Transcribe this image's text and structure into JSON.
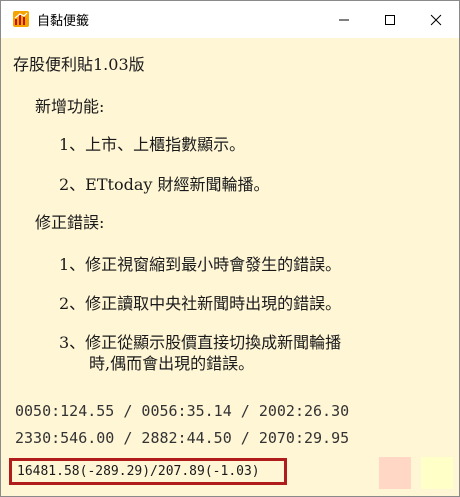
{
  "window": {
    "title": "自黏便籤",
    "controls": {
      "minimize": "minimize",
      "maximize": "maximize",
      "close": "close"
    }
  },
  "note": {
    "heading": "存股便利貼1.03版",
    "new_features_title": "新增功能:",
    "new_features": [
      "1、上市、上櫃指數顯示。",
      "2、ETtoday 財經新聞輪播。"
    ],
    "fixes_title": "修正錯誤:",
    "fixes": [
      "1、修正視窗縮到最小時會發生的錯誤。",
      "2、修正讀取中央社新聞時出現的錯誤。",
      "3、修正從顯示股價直接切換成新聞輪播",
      "時,偶而會出現的錯誤。"
    ]
  },
  "quotes": {
    "row1": "0050:124.55 / 0056:35.14 / 2002:26.30",
    "row2": "2330:546.00 / 2882:44.50 / 2070:29.95"
  },
  "index_bar": {
    "text": "16481.58(-289.29)/207.89(-1.03)"
  },
  "colors": {
    "note_background": "#fff6d6",
    "highlight_border": "#b01c1c",
    "swatch_pink": "#ffd7c4",
    "swatch_yellow": "#ffffc8"
  }
}
